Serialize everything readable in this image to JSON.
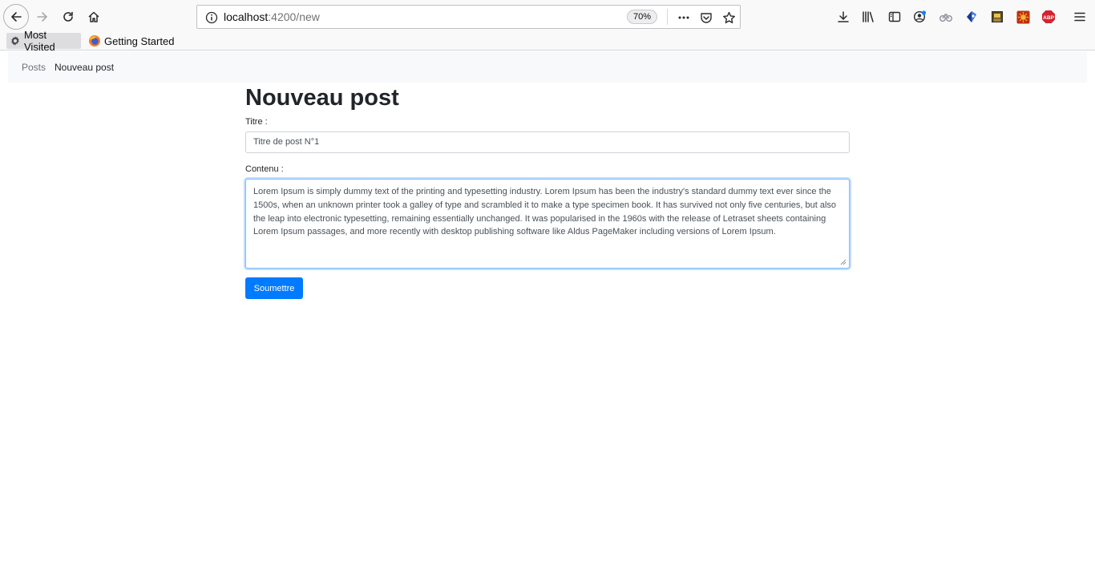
{
  "browser": {
    "url_host": "localhost",
    "url_path": ":4200/new",
    "zoom": "70%",
    "bookmarks": [
      {
        "label": "Most Visited",
        "icon": "gear-icon"
      },
      {
        "label": "Getting Started",
        "icon": "firefox-icon"
      }
    ],
    "toolbar_icons": [
      "download-icon",
      "library-icon",
      "sidebar-icon",
      "account-icon",
      "extension-icon",
      "shield-icon",
      "picture-icon",
      "sun-icon",
      "adblock-icon",
      "menu-icon"
    ],
    "adblock_badge": "ABP"
  },
  "breadcrumb": {
    "items": [
      "Posts",
      "Nouveau post"
    ]
  },
  "form": {
    "title": "Nouveau post",
    "title_label": "Titre :",
    "title_value": "Titre de post N°1",
    "content_label": "Contenu :",
    "content_value": "Lorem Ipsum is simply dummy text of the printing and typesetting industry. Lorem Ipsum has been the industry's standard dummy text ever since the 1500s, when an unknown printer took a galley of type and scrambled it to make a type specimen book. It has survived not only five centuries, but also the leap into electronic typesetting, remaining essentially unchanged. It was popularised in the 1960s with the release of Letraset sheets containing Lorem Ipsum passages, and more recently with desktop publishing software like Aldus PageMaker including versions of Lorem Ipsum.",
    "submit_label": "Soumettre"
  },
  "colors": {
    "primary": "#007bff",
    "breadcrumb_bg": "#f8f9fa",
    "focus_border": "#80bdff"
  }
}
